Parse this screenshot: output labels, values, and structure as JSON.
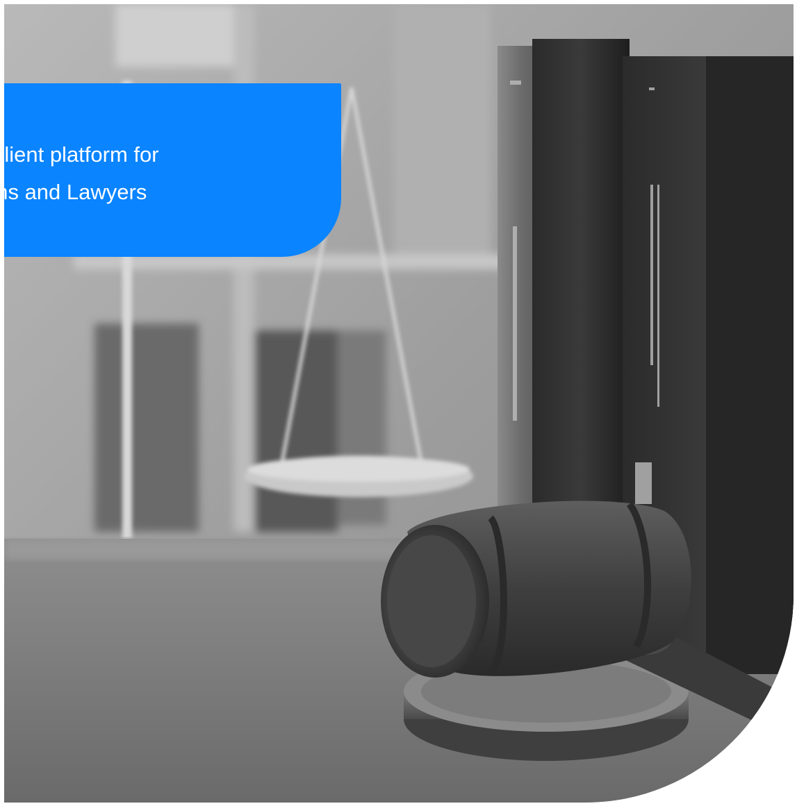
{
  "hero": {
    "image_alt": "Black-and-white photo of a wooden judge's gavel on a sound block, with scales of justice and law books in the background",
    "tagline": "Secure client platform for\nLaw Firms and Lawyers",
    "accent_color": "#0a84ff",
    "icons": [
      "gavel-icon",
      "scales-of-justice-icon",
      "law-books-icon"
    ]
  }
}
